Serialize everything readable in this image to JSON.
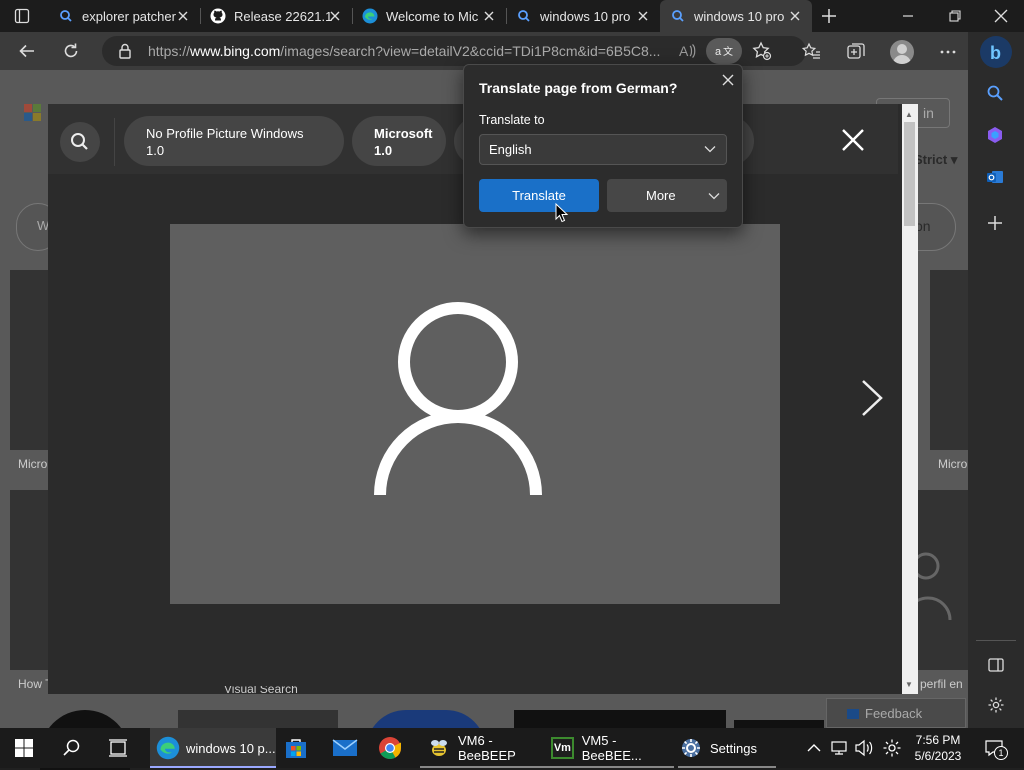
{
  "tabs": [
    {
      "title": "explorer patcher",
      "icon": "search-icon"
    },
    {
      "title": "Release 22621.1",
      "icon": "github-icon"
    },
    {
      "title": "Welcome to Mic",
      "icon": "edge-icon"
    },
    {
      "title": "windows 10 pro",
      "icon": "search-icon"
    },
    {
      "title": "windows 10 pro",
      "icon": "search-icon",
      "active": true
    }
  ],
  "address": {
    "prefix": "https://",
    "domain": "www.bing.com",
    "path": "/images/search?view=detailV2&ccid=TDi1P8cm&id=6B5C8..."
  },
  "background_page": {
    "header_button_partial": "in",
    "strict_partial": "Strict",
    "pill_partial_left": "W",
    "pill_partial_right": "on",
    "captions": [
      "Micro",
      "Micro",
      "How T",
      "perfil en"
    ],
    "bottom_partial": "Visual Search",
    "feedback": "Feedback"
  },
  "viewer": {
    "pills": [
      "No Profile Picture Windows 1.0",
      "Microsoft\n1.0"
    ]
  },
  "popup": {
    "title": "Translate page from German?",
    "translate_to_label": "Translate to",
    "selected_language": "English",
    "translate_button": "Translate",
    "more_button": "More"
  },
  "taskbar": {
    "apps": [
      {
        "label": "windows 10 p...",
        "icon": "edge-icon",
        "active": true
      },
      {
        "label": "",
        "icon": "store-icon"
      },
      {
        "label": "",
        "icon": "mail-icon"
      },
      {
        "label": "",
        "icon": "chrome-icon"
      },
      {
        "label": "VM6 - BeeBEEP",
        "icon": "beebeep-icon"
      },
      {
        "label": "VM5 - BeeBEE...",
        "icon": "vmware-icon"
      },
      {
        "label": "Settings",
        "icon": "settings-icon"
      }
    ],
    "time": "7:56 PM",
    "date": "5/6/2023",
    "notification_count": "1"
  },
  "colors": {
    "accent": "#1a70c8",
    "tab_active": "#3b3b3b",
    "page_bg": "#595959"
  }
}
